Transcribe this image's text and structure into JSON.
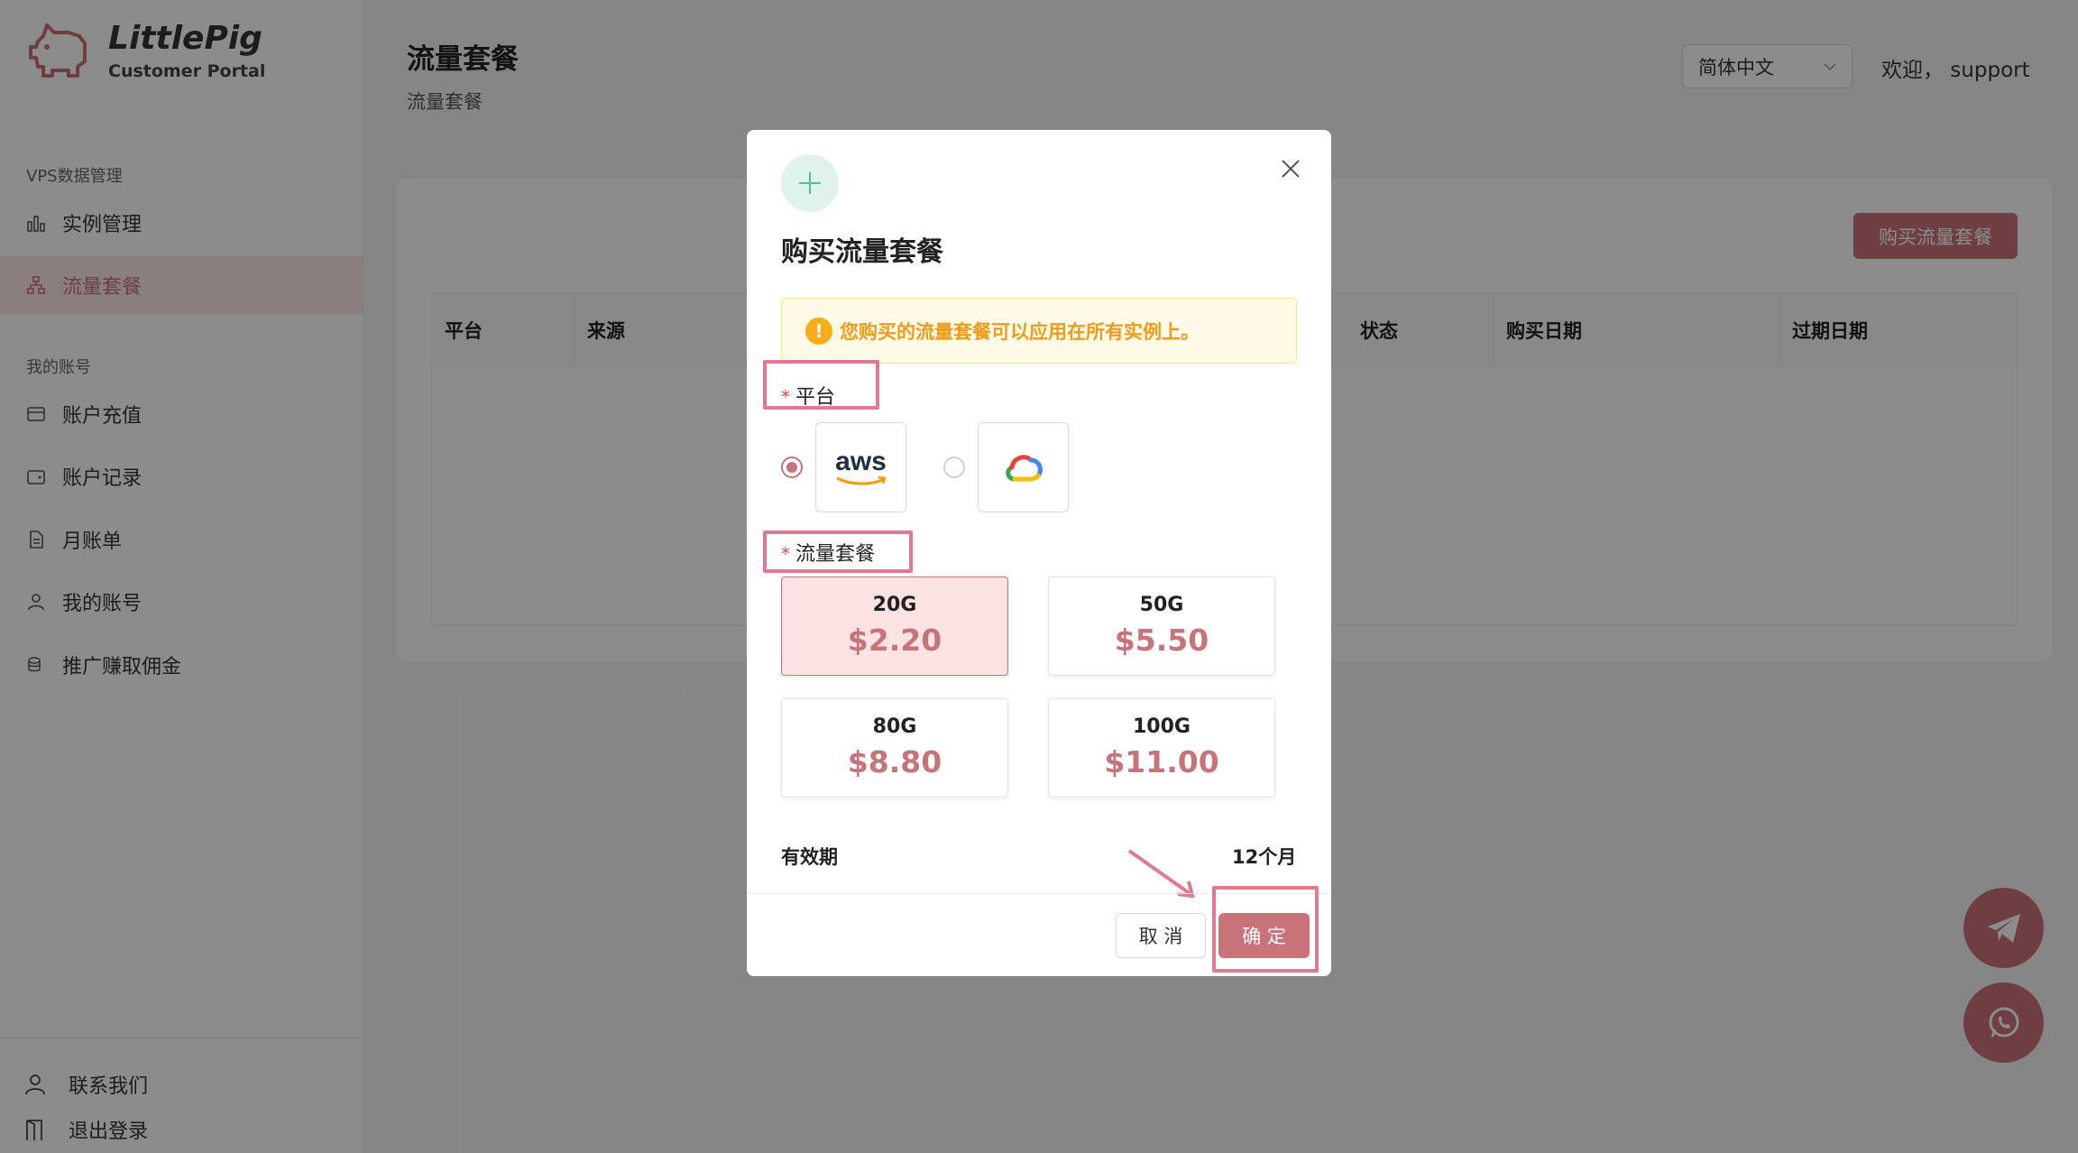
{
  "brand": {
    "title": "LittlePig",
    "subtitle": "Customer Portal"
  },
  "sidebar": {
    "sections": [
      {
        "label": "VPS数据管理"
      },
      {
        "label": "我的账号"
      }
    ],
    "items": [
      {
        "label": "实例管理",
        "icon": "bar-chart-icon"
      },
      {
        "label": "流量套餐",
        "icon": "network-icon",
        "active": true
      },
      {
        "label": "账户充值",
        "icon": "card-icon"
      },
      {
        "label": "账户记录",
        "icon": "wallet-icon"
      },
      {
        "label": "月账单",
        "icon": "document-icon"
      },
      {
        "label": "我的账号",
        "icon": "user-icon"
      },
      {
        "label": "推广赚取佣金",
        "icon": "coins-icon"
      }
    ],
    "footer": [
      {
        "label": "联系我们",
        "icon": "user-icon"
      },
      {
        "label": "退出登录",
        "icon": "logout-icon"
      }
    ]
  },
  "header": {
    "title": "流量套餐",
    "breadcrumb": "流量套餐",
    "language": "简体中文",
    "welcome": "欢迎， support"
  },
  "content": {
    "buy_button": "购买流量套餐",
    "table_headers": [
      "平台",
      "来源",
      "状态",
      "购买日期",
      "过期日期"
    ]
  },
  "modal": {
    "title": "购买流量套餐",
    "alert": "您购买的流量套餐可以应用在所有实例上。",
    "platform_label": "平台",
    "platforms": [
      {
        "name": "aws",
        "selected": true
      },
      {
        "name": "google-cloud",
        "selected": false
      }
    ],
    "plan_label": "流量套餐",
    "plans": [
      {
        "name": "20G",
        "price": "$2.20",
        "selected": true
      },
      {
        "name": "50G",
        "price": "$5.50",
        "selected": false
      },
      {
        "name": "80G",
        "price": "$8.80",
        "selected": false
      },
      {
        "name": "100G",
        "price": "$11.00",
        "selected": false
      }
    ],
    "validity_label": "有效期",
    "validity_value": "12个月",
    "cancel_label": "取 消",
    "ok_label": "确 定"
  },
  "colors": {
    "accent": "#c8727a",
    "highlight": "#e07a8f",
    "alert_text": "#f29a1a"
  }
}
